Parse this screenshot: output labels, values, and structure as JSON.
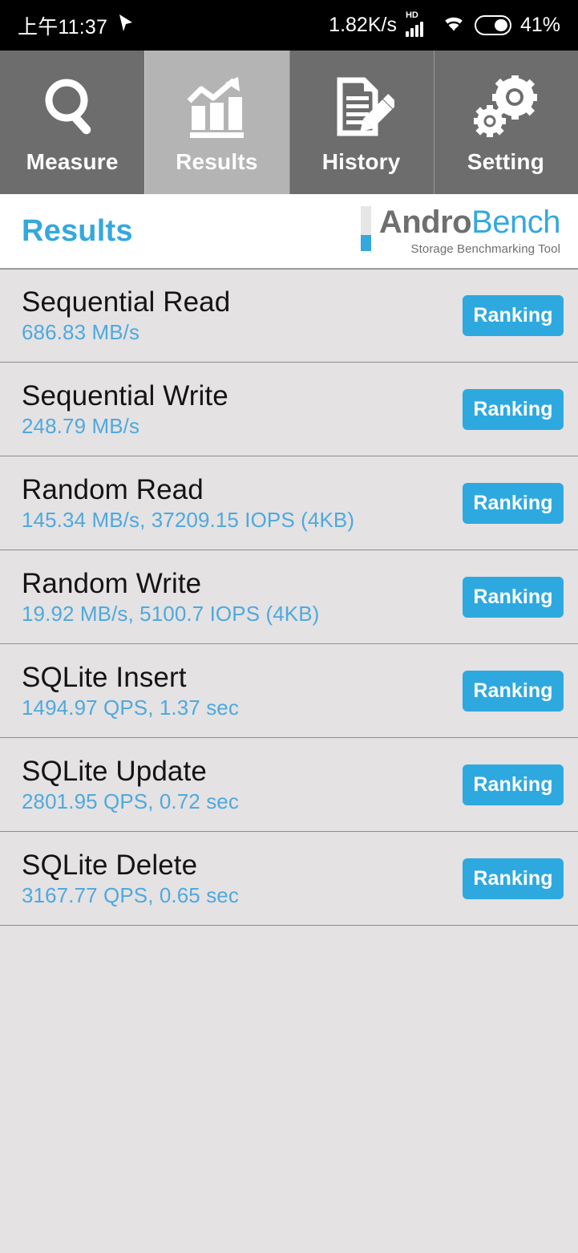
{
  "statusbar": {
    "time": "上午11:37",
    "cursor_icon": "navigation-arrow-icon",
    "network_speed": "1.82K/s",
    "hd_label": "HD",
    "signal_icon": "signal-bars-icon",
    "wifi_icon": "wifi-icon",
    "battery_icon": "battery-icon",
    "battery_percent": "41%"
  },
  "tabs": [
    {
      "label": "Measure",
      "icon": "magnifier-icon",
      "selected": false
    },
    {
      "label": "Results",
      "icon": "bar-chart-arrow-icon",
      "selected": true
    },
    {
      "label": "History",
      "icon": "document-pencil-icon",
      "selected": false
    },
    {
      "label": "Setting",
      "icon": "gears-icon",
      "selected": false
    }
  ],
  "header": {
    "title": "Results",
    "brand_first": "Andro",
    "brand_second": "Bench",
    "tagline": "Storage Benchmarking Tool"
  },
  "results": [
    {
      "title": "Sequential Read",
      "value": "686.83 MB/s",
      "button": "Ranking"
    },
    {
      "title": "Sequential Write",
      "value": "248.79 MB/s",
      "button": "Ranking"
    },
    {
      "title": "Random Read",
      "value": "145.34 MB/s, 37209.15 IOPS (4KB)",
      "button": "Ranking"
    },
    {
      "title": "Random Write",
      "value": "19.92 MB/s, 5100.7 IOPS (4KB)",
      "button": "Ranking"
    },
    {
      "title": "SQLite Insert",
      "value": "1494.97 QPS, 1.37 sec",
      "button": "Ranking"
    },
    {
      "title": "SQLite Update",
      "value": "2801.95 QPS, 0.72 sec",
      "button": "Ranking"
    },
    {
      "title": "SQLite Delete",
      "value": "3167.77 QPS, 0.65 sec",
      "button": "Ranking"
    }
  ],
  "colors": {
    "accent_blue": "#2ea9e0",
    "title_blue": "#35a8dd",
    "value_blue": "#4fa9dd",
    "tab_bg": "#6d6d6d",
    "tab_selected_bg": "#b4b4b4",
    "list_bg": "#e4e2e3",
    "brand_gray": "#6f6f6f"
  }
}
